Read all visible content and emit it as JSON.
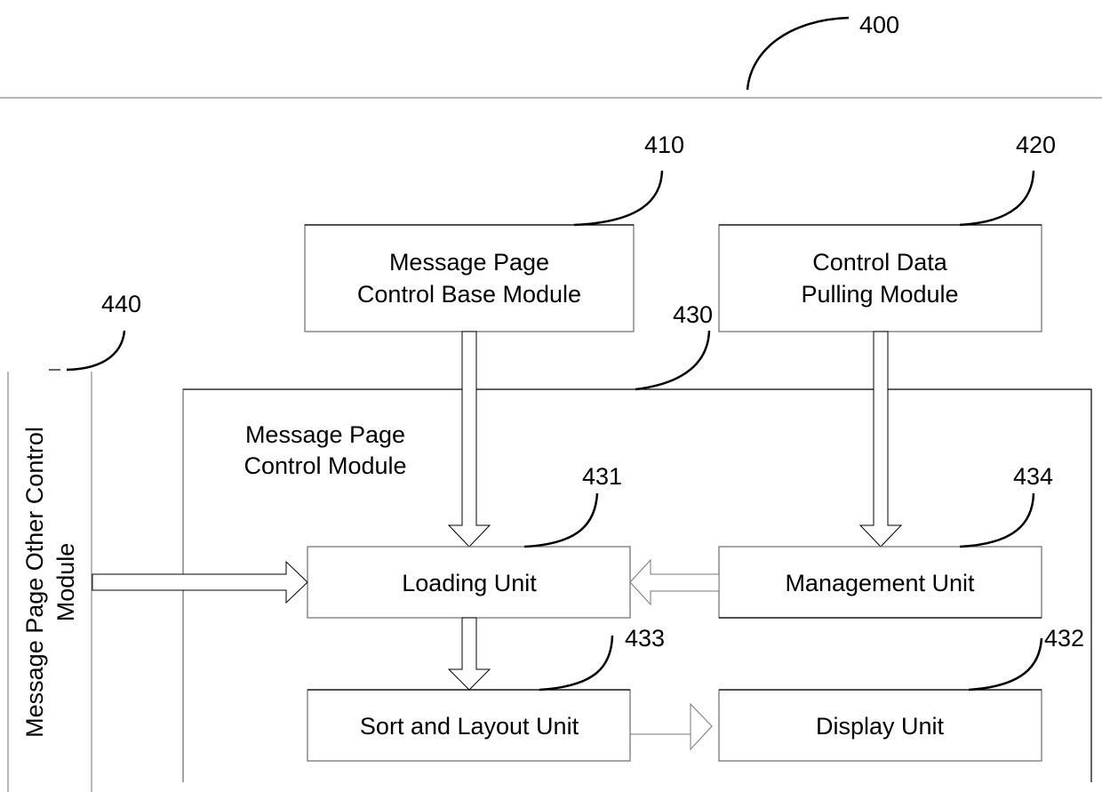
{
  "figure": {
    "ref": "400"
  },
  "modules": {
    "base": {
      "ref": "410",
      "line1": "Message Page",
      "line2": "Control Base Module"
    },
    "pulling": {
      "ref": "420",
      "line1": "Control Data",
      "line2": "Pulling Module"
    },
    "control": {
      "ref": "430",
      "line1": "Message Page",
      "line2": "Control Module"
    },
    "other": {
      "ref": "440",
      "line1": "Message Page Other Control",
      "line2": "Module"
    }
  },
  "units": {
    "loading": {
      "ref": "431",
      "label": "Loading Unit"
    },
    "display": {
      "ref": "432",
      "label": "Display Unit"
    },
    "sort": {
      "ref": "433",
      "label": "Sort and Layout Unit"
    },
    "management": {
      "ref": "434",
      "label": "Management Unit"
    }
  },
  "connections": [
    {
      "from": "Message Page Control Base Module",
      "to": "Loading Unit"
    },
    {
      "from": "Control Data Pulling Module",
      "to": "Management Unit"
    },
    {
      "from": "Message Page Other Control Module",
      "to": "Loading Unit"
    },
    {
      "from": "Management Unit",
      "to": "Loading Unit"
    },
    {
      "from": "Loading Unit",
      "to": "Sort and Layout Unit"
    },
    {
      "from": "Sort and Layout Unit",
      "to": "Display Unit"
    }
  ]
}
